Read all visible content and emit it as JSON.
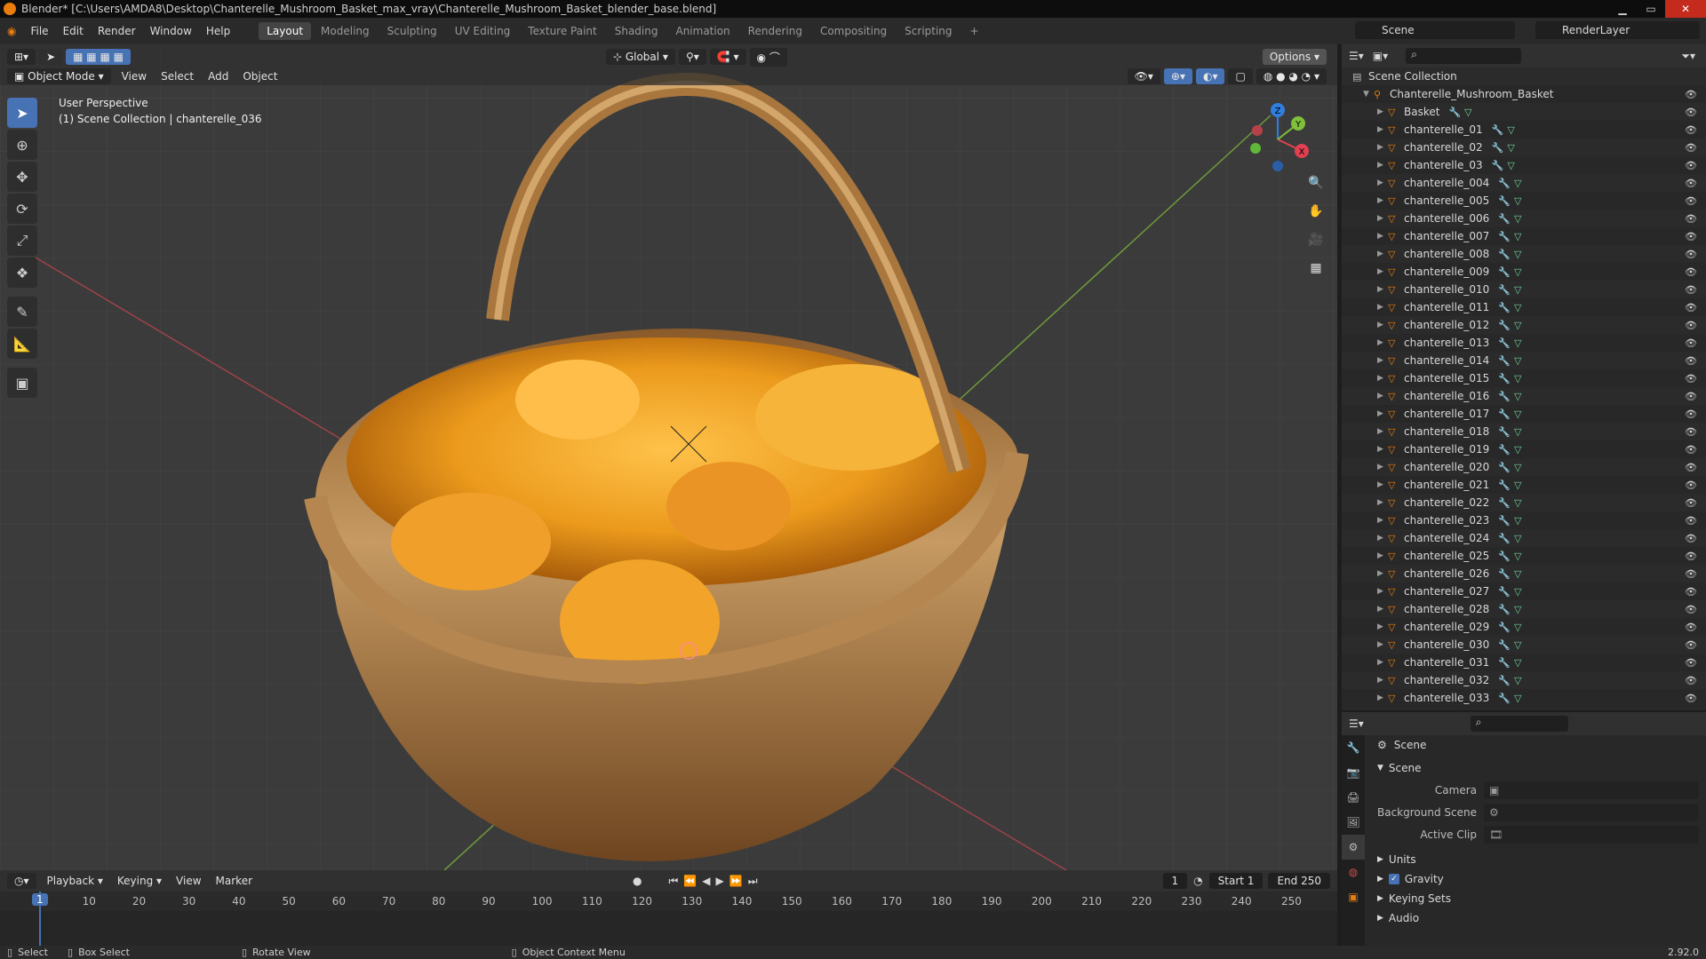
{
  "title_bar": {
    "text": "Blender* [C:\\Users\\AMDA8\\Desktop\\Chanterelle_Mushroom_Basket_max_vray\\Chanterelle_Mushroom_Basket_blender_base.blend]"
  },
  "menus": [
    "File",
    "Edit",
    "Render",
    "Window",
    "Help"
  ],
  "workspaces": [
    "Layout",
    "Modeling",
    "Sculpting",
    "UV Editing",
    "Texture Paint",
    "Shading",
    "Animation",
    "Rendering",
    "Compositing",
    "Scripting"
  ],
  "active_workspace": "Layout",
  "scene_name": "Scene",
  "render_layer": "RenderLayer",
  "viewport": {
    "mode": "Object Mode",
    "menus": [
      "View",
      "Select",
      "Add",
      "Object"
    ],
    "transform_orientation": "Global",
    "options_label": "Options",
    "info_line1": "User Perspective",
    "info_line2": "(1) Scene Collection | chanterelle_036",
    "gizmo_axes": [
      "X",
      "Y",
      "Z"
    ]
  },
  "tools": [
    "select-box",
    "cursor",
    "move",
    "rotate",
    "scale",
    "transform",
    "annotate",
    "measure",
    "add-cube"
  ],
  "outliner": {
    "root": "Scene Collection",
    "collection": "Chanterelle_Mushroom_Basket",
    "items": [
      "Basket",
      "chanterelle_01",
      "chanterelle_02",
      "chanterelle_03",
      "chanterelle_004",
      "chanterelle_005",
      "chanterelle_006",
      "chanterelle_007",
      "chanterelle_008",
      "chanterelle_009",
      "chanterelle_010",
      "chanterelle_011",
      "chanterelle_012",
      "chanterelle_013",
      "chanterelle_014",
      "chanterelle_015",
      "chanterelle_016",
      "chanterelle_017",
      "chanterelle_018",
      "chanterelle_019",
      "chanterelle_020",
      "chanterelle_021",
      "chanterelle_022",
      "chanterelle_023",
      "chanterelle_024",
      "chanterelle_025",
      "chanterelle_026",
      "chanterelle_027",
      "chanterelle_028",
      "chanterelle_029",
      "chanterelle_030",
      "chanterelle_031",
      "chanterelle_032",
      "chanterelle_033"
    ]
  },
  "properties": {
    "context": "Scene",
    "panel": "Scene",
    "camera_label": "Camera",
    "background_scene_label": "Background Scene",
    "active_clip_label": "Active Clip",
    "subpanels": [
      "Units",
      "Gravity",
      "Keying Sets",
      "Audio"
    ],
    "gravity_checked": true
  },
  "timeline": {
    "menus": [
      "Playback",
      "Keying",
      "View",
      "Marker"
    ],
    "current_frame": "1",
    "start_label": "Start",
    "start": "1",
    "end_label": "End",
    "end": "250",
    "ticks": [
      "1",
      "10",
      "20",
      "30",
      "40",
      "50",
      "60",
      "70",
      "80",
      "90",
      "100",
      "110",
      "120",
      "130",
      "140",
      "150",
      "160",
      "170",
      "180",
      "190",
      "200",
      "210",
      "220",
      "230",
      "240",
      "250"
    ]
  },
  "status_bar": {
    "select": "Select",
    "box_select": "Box Select",
    "rotate_view": "Rotate View",
    "context_menu": "Object Context Menu",
    "version": "2.92.0"
  }
}
